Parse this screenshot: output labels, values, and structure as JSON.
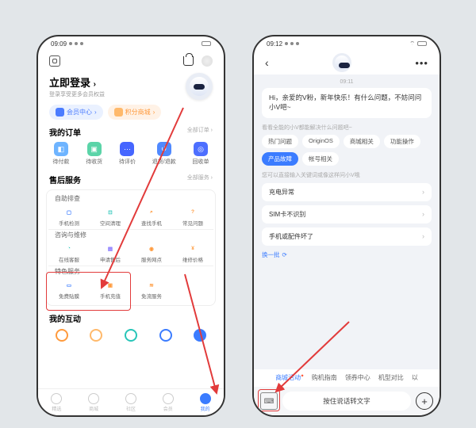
{
  "left": {
    "status_time": "09:09",
    "login_title": "立即登录",
    "login_sub": "登录享受更多会员权益",
    "pills": {
      "member": "会员中心",
      "points": "积分商城"
    },
    "orders": {
      "title": "我的订单",
      "more": "全部订单",
      "items": [
        "待付款",
        "待收货",
        "待评价",
        "退货/退款",
        "回收单"
      ]
    },
    "service": {
      "title": "售后服务",
      "more": "全部服务",
      "group1_title": "自助排查",
      "group1": [
        "手机检测",
        "空间清理",
        "查找手机",
        "常见问题"
      ],
      "group2_title": "咨询与维修",
      "group2": [
        "在线客服",
        "申请售后",
        "服务网点",
        "维修价格"
      ],
      "group3_title": "特色服务",
      "group3": [
        "免费贴膜",
        "手机充值",
        "免流服务"
      ]
    },
    "interact_title": "我的互动",
    "tabs": [
      "精选",
      "商城",
      "社区",
      "会员",
      "我的"
    ]
  },
  "right": {
    "status_time": "09:12",
    "chat_time": "09:11",
    "greeting": "Hi，亲爱的V粉，新年快乐！有什么问题，不妨问问小V吧~",
    "hint1": "看看全能的小V都能解决什么问题吧~",
    "chips": [
      "热门问题",
      "OriginOS",
      "商城相关",
      "功能操作",
      "产品故障",
      "帐号相关"
    ],
    "hint2": "您可以直接输入关键词或像这样问小V哦",
    "questions": [
      "充电异常",
      "SIM卡不识别",
      "手机或配件坏了"
    ],
    "refresh": "换一批",
    "tags": [
      "商城活动",
      "购机指南",
      "领券中心",
      "机型对比",
      "以"
    ],
    "voice_placeholder": "按住说话转文字"
  }
}
